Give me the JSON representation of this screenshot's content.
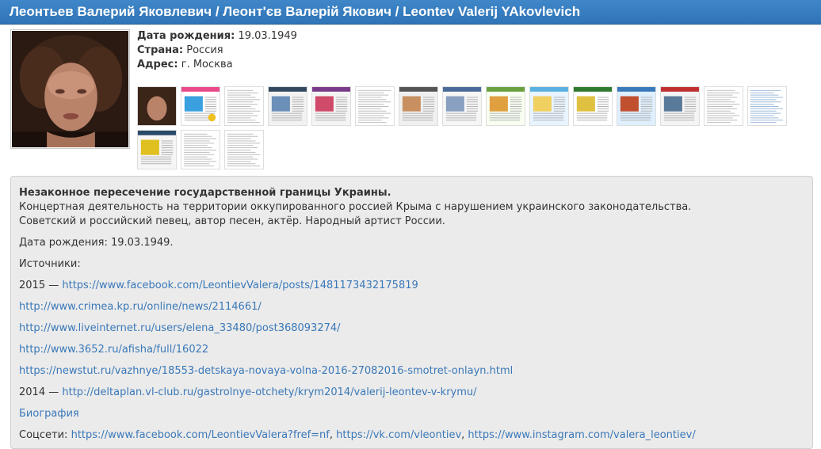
{
  "header": {
    "title": "Леонтьев Валерий Яковлевич / Леонт'єв Валерій Якович / Leontev Valerij YAkovlevich"
  },
  "profile": {
    "birth_label": "Дата рождения:",
    "birth_value": "19.03.1949",
    "country_label": "Страна:",
    "country_value": "Россия",
    "address_label": "Адрес:",
    "address_value": "г. Москва"
  },
  "thumbnails": [
    {
      "style": "photo"
    },
    {
      "style": "web-colorful"
    },
    {
      "style": "text"
    },
    {
      "style": "web-dark"
    },
    {
      "style": "web-purple"
    },
    {
      "style": "text"
    },
    {
      "style": "web-mixed"
    },
    {
      "style": "web-banner"
    },
    {
      "style": "web-green"
    },
    {
      "style": "web-sky"
    },
    {
      "style": "web-crimea"
    },
    {
      "style": "web-sea"
    },
    {
      "style": "web-red"
    },
    {
      "style": "text"
    },
    {
      "style": "text-blue"
    },
    {
      "style": "web-yellow"
    },
    {
      "style": "text"
    },
    {
      "style": "text"
    }
  ],
  "description": {
    "heading": "Незаконное пересечение государственной границы Украины.",
    "line1": "Концертная деятельность на территории оккупированного россией Крыма с нарушением украинского законодательства.",
    "line2": "Советский и российский певец, автор песен, актёр. Народный артист России.",
    "birth": "Дата рождения: 19.03.1949.",
    "sources_label": "Источники:",
    "year_2015": "2015 —",
    "link_fb_post": "https://www.facebook.com/LeontievValera/posts/1481173432175819",
    "link_kp": "http://www.crimea.kp.ru/online/news/2114661/",
    "link_li": "http://www.liveinternet.ru/users/elena_33480/post368093274/",
    "link_3652": "http://www.3652.ru/afisha/full/16022",
    "link_newstut": "https://newstut.ru/vazhnye/18553-detskaya-novaya-volna-2016-27082016-smotret-onlayn.html",
    "year_2014": "2014 —",
    "link_deltaplan": "http://deltaplan.vl-club.ru/gastrolnye-otchety/krym2014/valerij-leontev-v-krymu/",
    "bio_link": "Биография",
    "social_label": "Соцсети:",
    "social_fb": "https://www.facebook.com/LeontievValera?fref=nf",
    "social_vk": "https://vk.com/vleontiev",
    "social_ig": "https://www.instagram.com/valera_leontiev/"
  }
}
